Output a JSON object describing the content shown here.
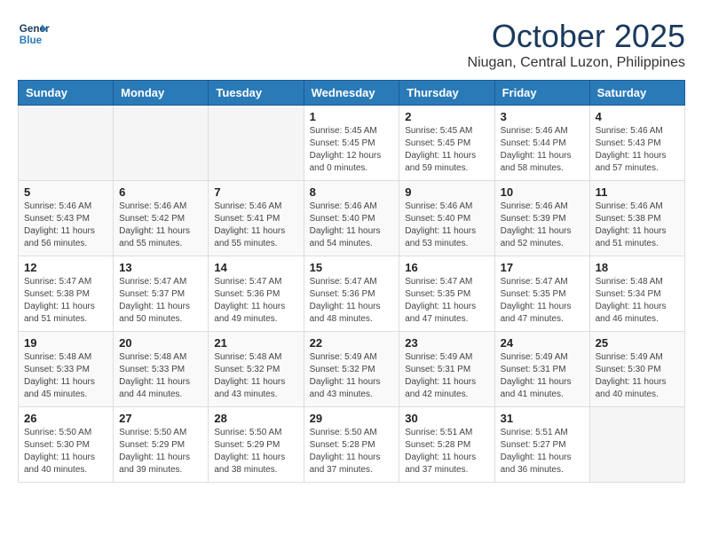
{
  "logo": {
    "line1": "General",
    "line2": "Blue"
  },
  "title": "October 2025",
  "location": "Niugan, Central Luzon, Philippines",
  "weekdays": [
    "Sunday",
    "Monday",
    "Tuesday",
    "Wednesday",
    "Thursday",
    "Friday",
    "Saturday"
  ],
  "weeks": [
    [
      {
        "day": "",
        "info": ""
      },
      {
        "day": "",
        "info": ""
      },
      {
        "day": "",
        "info": ""
      },
      {
        "day": "1",
        "info": "Sunrise: 5:45 AM\nSunset: 5:45 PM\nDaylight: 12 hours\nand 0 minutes."
      },
      {
        "day": "2",
        "info": "Sunrise: 5:45 AM\nSunset: 5:45 PM\nDaylight: 11 hours\nand 59 minutes."
      },
      {
        "day": "3",
        "info": "Sunrise: 5:46 AM\nSunset: 5:44 PM\nDaylight: 11 hours\nand 58 minutes."
      },
      {
        "day": "4",
        "info": "Sunrise: 5:46 AM\nSunset: 5:43 PM\nDaylight: 11 hours\nand 57 minutes."
      }
    ],
    [
      {
        "day": "5",
        "info": "Sunrise: 5:46 AM\nSunset: 5:43 PM\nDaylight: 11 hours\nand 56 minutes."
      },
      {
        "day": "6",
        "info": "Sunrise: 5:46 AM\nSunset: 5:42 PM\nDaylight: 11 hours\nand 55 minutes."
      },
      {
        "day": "7",
        "info": "Sunrise: 5:46 AM\nSunset: 5:41 PM\nDaylight: 11 hours\nand 55 minutes."
      },
      {
        "day": "8",
        "info": "Sunrise: 5:46 AM\nSunset: 5:40 PM\nDaylight: 11 hours\nand 54 minutes."
      },
      {
        "day": "9",
        "info": "Sunrise: 5:46 AM\nSunset: 5:40 PM\nDaylight: 11 hours\nand 53 minutes."
      },
      {
        "day": "10",
        "info": "Sunrise: 5:46 AM\nSunset: 5:39 PM\nDaylight: 11 hours\nand 52 minutes."
      },
      {
        "day": "11",
        "info": "Sunrise: 5:46 AM\nSunset: 5:38 PM\nDaylight: 11 hours\nand 51 minutes."
      }
    ],
    [
      {
        "day": "12",
        "info": "Sunrise: 5:47 AM\nSunset: 5:38 PM\nDaylight: 11 hours\nand 51 minutes."
      },
      {
        "day": "13",
        "info": "Sunrise: 5:47 AM\nSunset: 5:37 PM\nDaylight: 11 hours\nand 50 minutes."
      },
      {
        "day": "14",
        "info": "Sunrise: 5:47 AM\nSunset: 5:36 PM\nDaylight: 11 hours\nand 49 minutes."
      },
      {
        "day": "15",
        "info": "Sunrise: 5:47 AM\nSunset: 5:36 PM\nDaylight: 11 hours\nand 48 minutes."
      },
      {
        "day": "16",
        "info": "Sunrise: 5:47 AM\nSunset: 5:35 PM\nDaylight: 11 hours\nand 47 minutes."
      },
      {
        "day": "17",
        "info": "Sunrise: 5:47 AM\nSunset: 5:35 PM\nDaylight: 11 hours\nand 47 minutes."
      },
      {
        "day": "18",
        "info": "Sunrise: 5:48 AM\nSunset: 5:34 PM\nDaylight: 11 hours\nand 46 minutes."
      }
    ],
    [
      {
        "day": "19",
        "info": "Sunrise: 5:48 AM\nSunset: 5:33 PM\nDaylight: 11 hours\nand 45 minutes."
      },
      {
        "day": "20",
        "info": "Sunrise: 5:48 AM\nSunset: 5:33 PM\nDaylight: 11 hours\nand 44 minutes."
      },
      {
        "day": "21",
        "info": "Sunrise: 5:48 AM\nSunset: 5:32 PM\nDaylight: 11 hours\nand 43 minutes."
      },
      {
        "day": "22",
        "info": "Sunrise: 5:49 AM\nSunset: 5:32 PM\nDaylight: 11 hours\nand 43 minutes."
      },
      {
        "day": "23",
        "info": "Sunrise: 5:49 AM\nSunset: 5:31 PM\nDaylight: 11 hours\nand 42 minutes."
      },
      {
        "day": "24",
        "info": "Sunrise: 5:49 AM\nSunset: 5:31 PM\nDaylight: 11 hours\nand 41 minutes."
      },
      {
        "day": "25",
        "info": "Sunrise: 5:49 AM\nSunset: 5:30 PM\nDaylight: 11 hours\nand 40 minutes."
      }
    ],
    [
      {
        "day": "26",
        "info": "Sunrise: 5:50 AM\nSunset: 5:30 PM\nDaylight: 11 hours\nand 40 minutes."
      },
      {
        "day": "27",
        "info": "Sunrise: 5:50 AM\nSunset: 5:29 PM\nDaylight: 11 hours\nand 39 minutes."
      },
      {
        "day": "28",
        "info": "Sunrise: 5:50 AM\nSunset: 5:29 PM\nDaylight: 11 hours\nand 38 minutes."
      },
      {
        "day": "29",
        "info": "Sunrise: 5:50 AM\nSunset: 5:28 PM\nDaylight: 11 hours\nand 37 minutes."
      },
      {
        "day": "30",
        "info": "Sunrise: 5:51 AM\nSunset: 5:28 PM\nDaylight: 11 hours\nand 37 minutes."
      },
      {
        "day": "31",
        "info": "Sunrise: 5:51 AM\nSunset: 5:27 PM\nDaylight: 11 hours\nand 36 minutes."
      },
      {
        "day": "",
        "info": ""
      }
    ]
  ]
}
